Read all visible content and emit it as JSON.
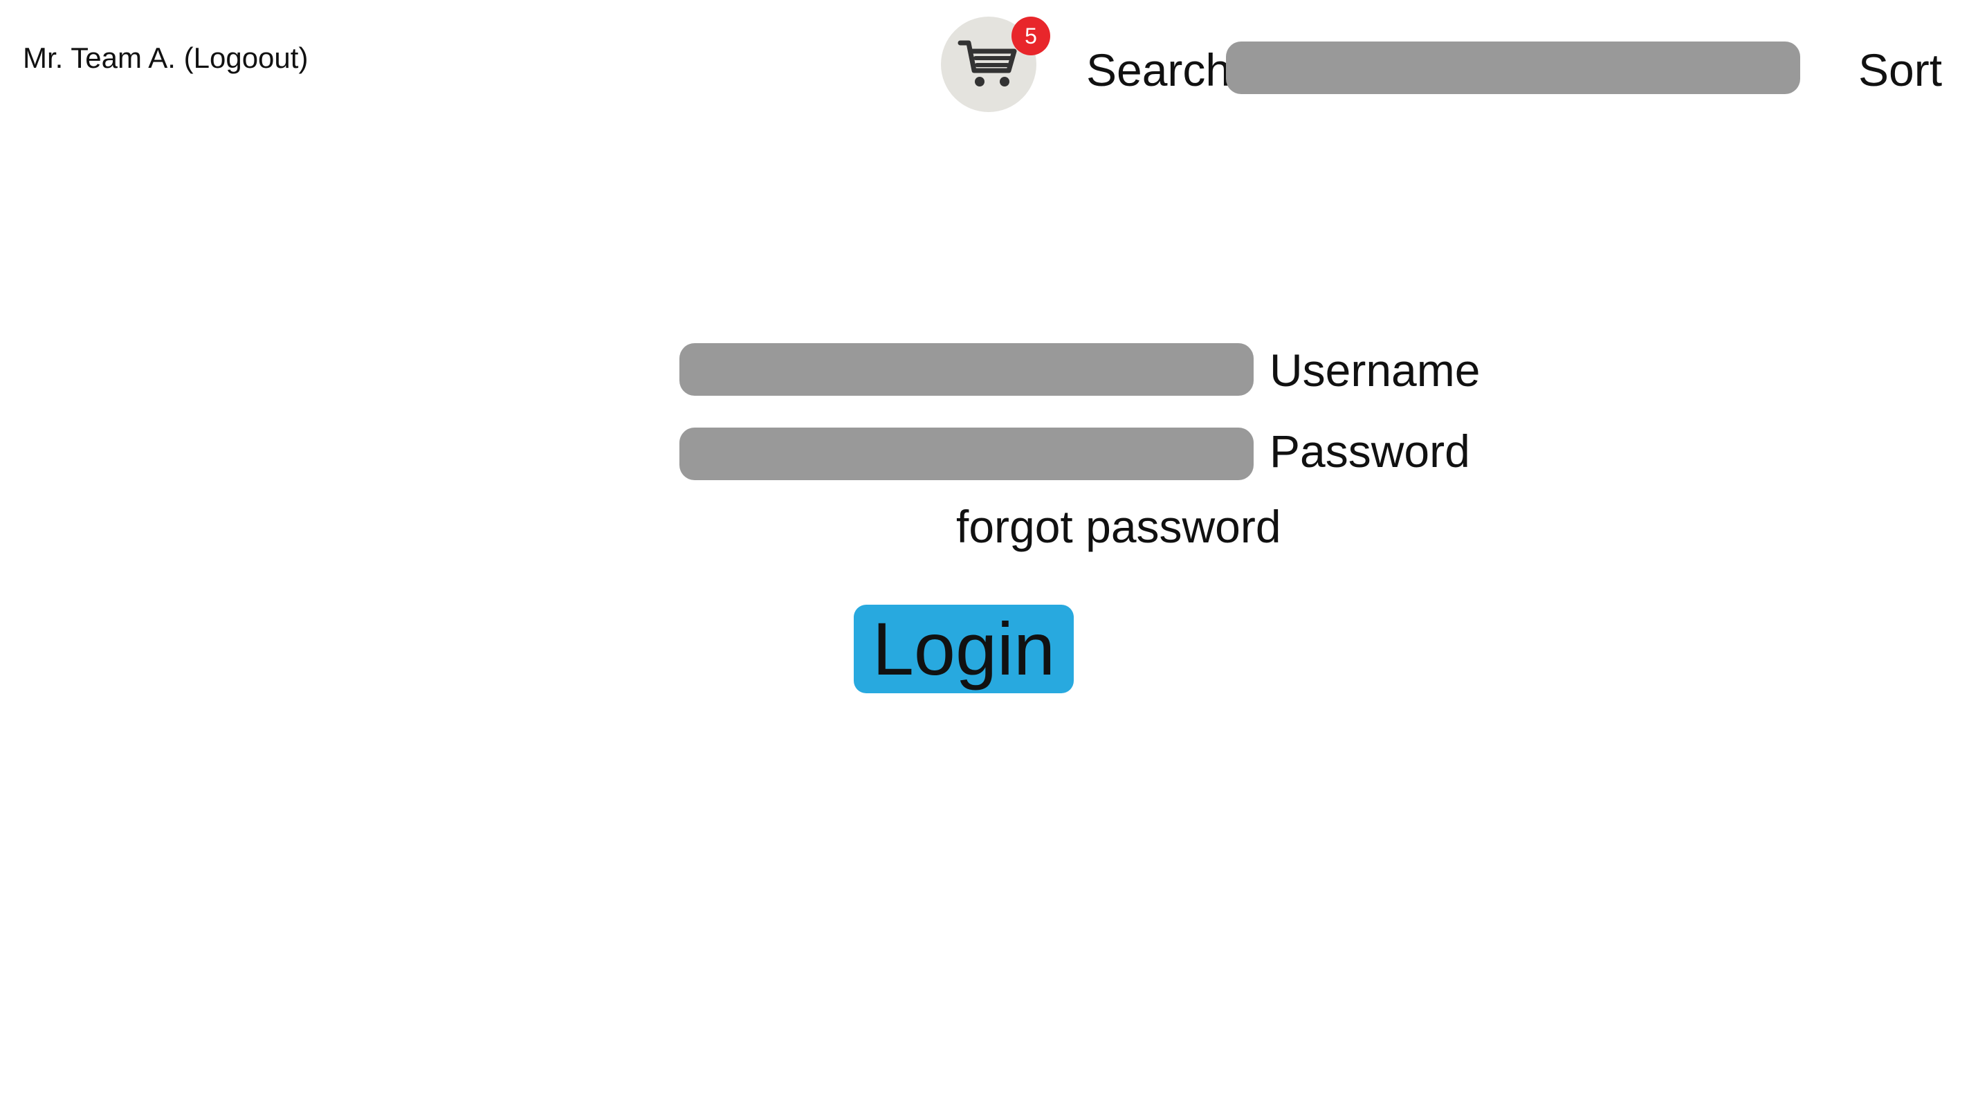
{
  "header": {
    "user_info": "Mr. Team A. (Logoout)",
    "cart": {
      "icon": "shopping-cart-icon",
      "badge_count": "5"
    },
    "search": {
      "label": "Search",
      "value": "",
      "placeholder": ""
    },
    "sort_label": "Sort"
  },
  "login_form": {
    "username": {
      "label": "Username",
      "value": ""
    },
    "password": {
      "label": "Password",
      "value": ""
    },
    "forgot_password_label": "forgot password",
    "login_button_label": "Login"
  },
  "colors": {
    "login_button": "#28a9df",
    "input_fill": "#999999",
    "badge": "#e8262b",
    "cart_circle": "#e4e3de"
  }
}
